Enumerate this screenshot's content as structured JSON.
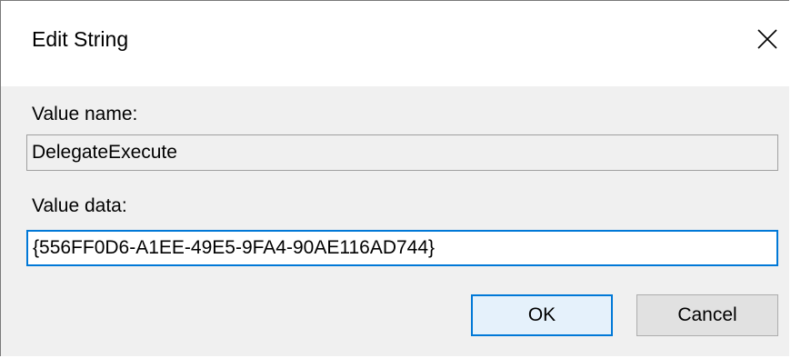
{
  "window": {
    "title": "Edit String",
    "close_icon": "close-icon"
  },
  "value_name": {
    "label": "Value name:",
    "value": "DelegateExecute"
  },
  "value_data": {
    "label": "Value data:",
    "value": "{556FF0D6-A1EE-49E5-9FA4-90AE116AD744}"
  },
  "buttons": {
    "ok_label": "OK",
    "cancel_label": "Cancel"
  },
  "colors": {
    "accent": "#0078d7",
    "dialog_background": "#f0f0f0",
    "titlebar_background": "#ffffff"
  }
}
